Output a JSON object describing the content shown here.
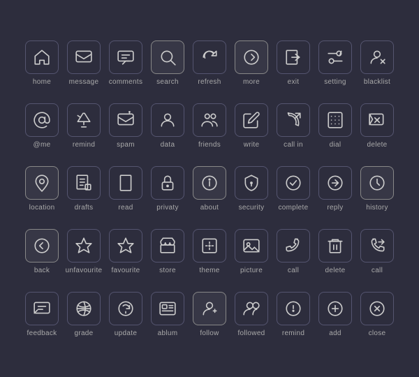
{
  "icons": [
    {
      "name": "home",
      "label": "home"
    },
    {
      "name": "message",
      "label": "message"
    },
    {
      "name": "comments",
      "label": "comments"
    },
    {
      "name": "search",
      "label": "search",
      "highlighted": true
    },
    {
      "name": "refresh",
      "label": "refresh"
    },
    {
      "name": "more",
      "label": "more",
      "highlighted": true
    },
    {
      "name": "exit",
      "label": "exit"
    },
    {
      "name": "setting",
      "label": "setting"
    },
    {
      "name": "blacklist",
      "label": "blacklist"
    },
    {
      "name": "at-me",
      "label": "@me"
    },
    {
      "name": "remind",
      "label": "remind"
    },
    {
      "name": "spam",
      "label": "spam"
    },
    {
      "name": "data",
      "label": "data"
    },
    {
      "name": "friends",
      "label": "friends"
    },
    {
      "name": "write",
      "label": "write"
    },
    {
      "name": "call-in",
      "label": "call in"
    },
    {
      "name": "dial",
      "label": "dial"
    },
    {
      "name": "delete",
      "label": "delete"
    },
    {
      "name": "location",
      "label": "location",
      "highlighted": true
    },
    {
      "name": "drafts",
      "label": "drafts"
    },
    {
      "name": "read",
      "label": "read"
    },
    {
      "name": "privacy",
      "label": "privaty"
    },
    {
      "name": "about",
      "label": "about",
      "highlighted": true
    },
    {
      "name": "security",
      "label": "security"
    },
    {
      "name": "complete",
      "label": "complete"
    },
    {
      "name": "reply",
      "label": "reply"
    },
    {
      "name": "history",
      "label": "history",
      "highlighted": true
    },
    {
      "name": "back",
      "label": "back",
      "highlighted": true
    },
    {
      "name": "unfavourite",
      "label": "unfavourite"
    },
    {
      "name": "favourite",
      "label": "favourite"
    },
    {
      "name": "store",
      "label": "store"
    },
    {
      "name": "theme",
      "label": "theme"
    },
    {
      "name": "picture",
      "label": "picture"
    },
    {
      "name": "call",
      "label": "call"
    },
    {
      "name": "delete-trash",
      "label": "delete"
    },
    {
      "name": "call-forward",
      "label": "call"
    },
    {
      "name": "feedback",
      "label": "feedback"
    },
    {
      "name": "grade",
      "label": "grade"
    },
    {
      "name": "update",
      "label": "update"
    },
    {
      "name": "ablum",
      "label": "ablum"
    },
    {
      "name": "follow",
      "label": "follow",
      "highlighted": true
    },
    {
      "name": "followed",
      "label": "followed"
    },
    {
      "name": "remind2",
      "label": "remind"
    },
    {
      "name": "add",
      "label": "add"
    },
    {
      "name": "close",
      "label": "close"
    }
  ]
}
